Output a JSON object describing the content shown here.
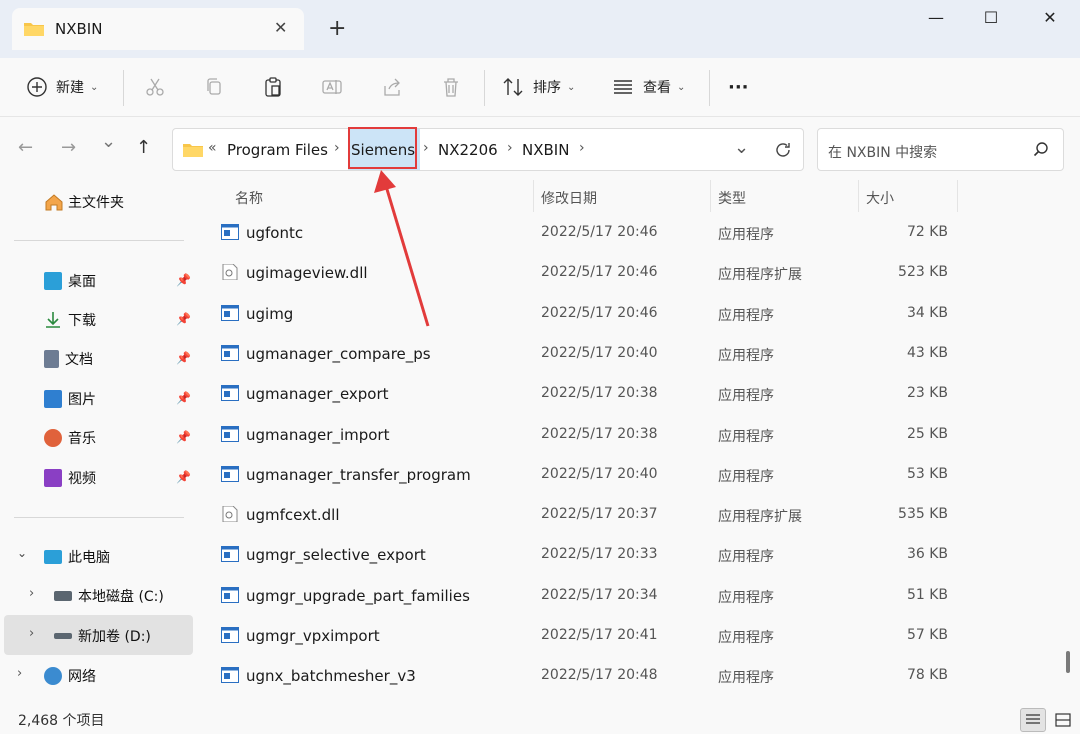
{
  "window": {
    "tab_title": "NXBIN",
    "tab_close": "✕",
    "new_tab": "+",
    "minimize": "—",
    "maximize": "☐",
    "close": "✕"
  },
  "toolbar": {
    "new_label": "新建",
    "sort_label": "排序",
    "view_label": "查看",
    "more_label": "···"
  },
  "nav": {
    "back": "←",
    "forward": "→",
    "recent": "⌄",
    "up": "↑",
    "breadcrumb_prefix": "«",
    "breadcrumbs": [
      "Program Files",
      "Siemens",
      "NX2206",
      "NXBIN"
    ],
    "search_placeholder": "在 NXBIN 中搜索"
  },
  "sidebar": {
    "home": "主文件夹",
    "quick": [
      {
        "label": "桌面",
        "icon": "desktop-icon",
        "color": "#2b9fd8"
      },
      {
        "label": "下载",
        "icon": "download-icon",
        "color": "#2a8a3e"
      },
      {
        "label": "文档",
        "icon": "document-icon",
        "color": "#6d7c93"
      },
      {
        "label": "图片",
        "icon": "picture-icon",
        "color": "#2f7fd0"
      },
      {
        "label": "音乐",
        "icon": "music-icon",
        "color": "#e0623b"
      },
      {
        "label": "视频",
        "icon": "video-icon",
        "color": "#8a3fc4"
      }
    ],
    "pc": "此电脑",
    "drives": [
      "本地磁盘 (C:)",
      "新加卷 (D:)"
    ],
    "network": "网络"
  },
  "columns": {
    "name": "名称",
    "date": "修改日期",
    "type": "类型",
    "size": "大小"
  },
  "files": [
    {
      "name": "ugfontc",
      "date": "2022/5/17 20:46",
      "type": "应用程序",
      "size": "72 KB",
      "kind": "exe"
    },
    {
      "name": "ugimageview.dll",
      "date": "2022/5/17 20:46",
      "type": "应用程序扩展",
      "size": "523 KB",
      "kind": "dll"
    },
    {
      "name": "ugimg",
      "date": "2022/5/17 20:46",
      "type": "应用程序",
      "size": "34 KB",
      "kind": "exe"
    },
    {
      "name": "ugmanager_compare_ps",
      "date": "2022/5/17 20:40",
      "type": "应用程序",
      "size": "43 KB",
      "kind": "exe"
    },
    {
      "name": "ugmanager_export",
      "date": "2022/5/17 20:38",
      "type": "应用程序",
      "size": "23 KB",
      "kind": "exe"
    },
    {
      "name": "ugmanager_import",
      "date": "2022/5/17 20:38",
      "type": "应用程序",
      "size": "25 KB",
      "kind": "exe"
    },
    {
      "name": "ugmanager_transfer_program",
      "date": "2022/5/17 20:40",
      "type": "应用程序",
      "size": "53 KB",
      "kind": "exe"
    },
    {
      "name": "ugmfcext.dll",
      "date": "2022/5/17 20:37",
      "type": "应用程序扩展",
      "size": "535 KB",
      "kind": "dll"
    },
    {
      "name": "ugmgr_selective_export",
      "date": "2022/5/17 20:33",
      "type": "应用程序",
      "size": "36 KB",
      "kind": "exe"
    },
    {
      "name": "ugmgr_upgrade_part_families",
      "date": "2022/5/17 20:34",
      "type": "应用程序",
      "size": "51 KB",
      "kind": "exe"
    },
    {
      "name": "ugmgr_vpximport",
      "date": "2022/5/17 20:41",
      "type": "应用程序",
      "size": "57 KB",
      "kind": "exe"
    },
    {
      "name": "ugnx_batchmesher_v3",
      "date": "2022/5/17 20:48",
      "type": "应用程序",
      "size": "78 KB",
      "kind": "exe"
    }
  ],
  "status": {
    "count": "2,468 个项目"
  }
}
